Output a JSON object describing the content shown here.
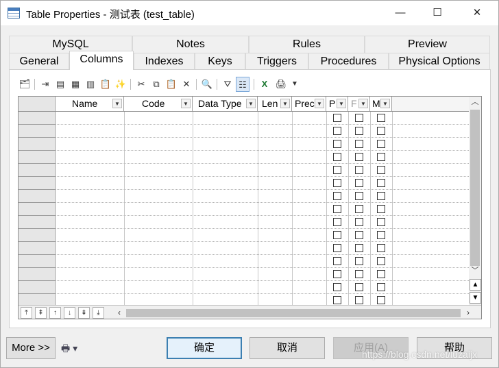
{
  "window": {
    "title": "Table Properties - 测试表 (test_table)",
    "app_icon": "table-icon",
    "minimize_label": "—",
    "maximize_label": "☐",
    "close_label": "✕"
  },
  "tabs": {
    "row_top": [
      {
        "label": "MySQL"
      },
      {
        "label": "Notes"
      },
      {
        "label": "Rules"
      },
      {
        "label": "Preview"
      }
    ],
    "row_bottom": [
      {
        "label": "General"
      },
      {
        "label": "Columns"
      },
      {
        "label": "Indexes"
      },
      {
        "label": "Keys"
      },
      {
        "label": "Triggers"
      },
      {
        "label": "Procedures"
      },
      {
        "label": "Physical Options"
      }
    ],
    "active": "Columns"
  },
  "toolbar": {
    "icons": [
      "properties-icon",
      "insert-row-icon",
      "add-row-icon",
      "add-rows-icon",
      "add-columns-icon",
      "paste-column-icon",
      "new-item-icon",
      "cut-icon",
      "copy-icon",
      "paste-icon",
      "delete-icon",
      "find-icon",
      "filter-icon",
      "customize-columns-icon",
      "excel-export-icon",
      "print-icon",
      "dropdown-arrow-icon"
    ]
  },
  "grid": {
    "columns": [
      {
        "label": "Name"
      },
      {
        "label": "Code"
      },
      {
        "label": "Data Type"
      },
      {
        "label": "Len"
      },
      {
        "label": "Prec"
      },
      {
        "label": "P"
      },
      {
        "label": "F"
      },
      {
        "label": "M"
      }
    ],
    "row_count": 15,
    "checkboxes_checked": false
  },
  "nav": {
    "buttons": [
      "move-top-icon",
      "move-up-page-icon",
      "move-up-icon",
      "move-down-icon",
      "move-down-page-icon",
      "move-bottom-icon"
    ]
  },
  "footer": {
    "more_label": "More >>",
    "print_icon": "printer-icon",
    "ok_label": "确定",
    "cancel_label": "取消",
    "apply_label": "应用(A)",
    "help_label": "帮助"
  },
  "watermark": "https://blog.csdn.net/luzaijx"
}
